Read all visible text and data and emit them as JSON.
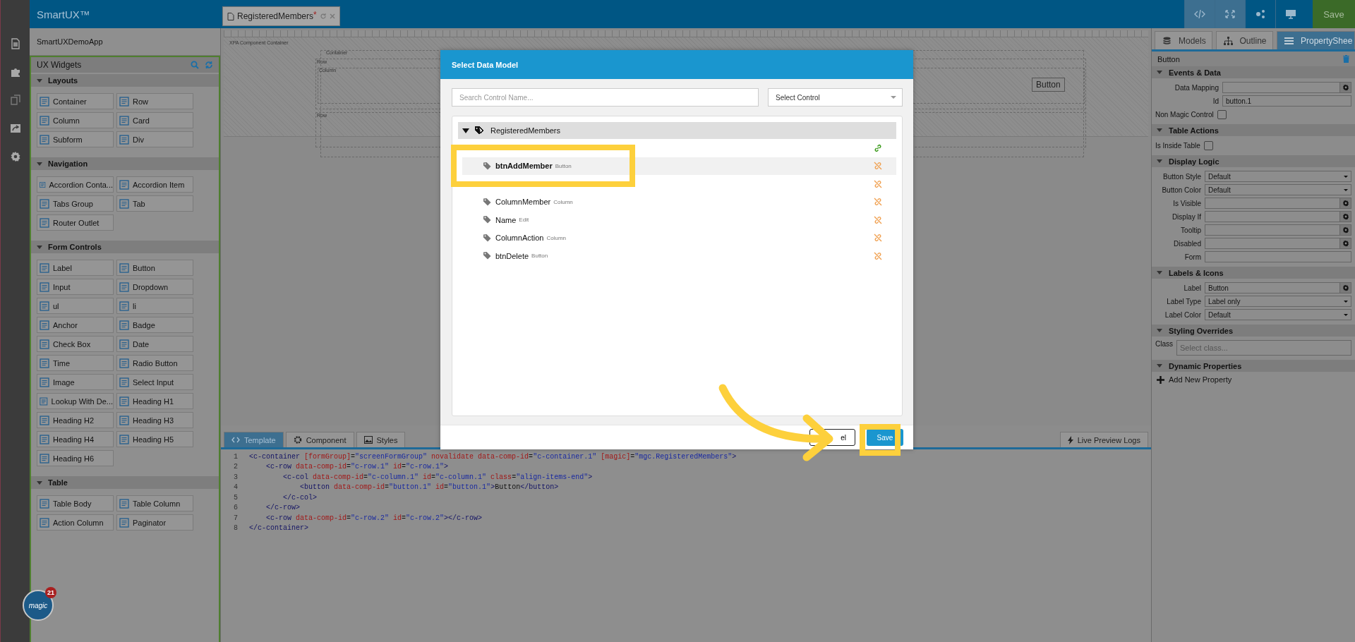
{
  "app": {
    "title": "SmartUX™",
    "project": "SmartUXDemoApp",
    "save": "Save"
  },
  "file_tab": {
    "label": "RegisteredMembers",
    "modified_mark": "*"
  },
  "toolbar": [
    {
      "kind": "code",
      "selected": true
    },
    {
      "kind": "expand",
      "selected": true
    },
    {
      "kind": "share",
      "selected": false
    },
    {
      "kind": "monitor",
      "selected": false
    }
  ],
  "widgets": {
    "title": "UX Widgets",
    "groups": [
      {
        "name": "Layouts",
        "expanded": true,
        "items": [
          "Container",
          "Row",
          "Column",
          "Card",
          "Subform",
          "Div"
        ]
      },
      {
        "name": "Navigation",
        "expanded": true,
        "items": [
          "Accordion Conta...",
          "Accordion Item",
          "Tabs Group",
          "Tab",
          "Router Outlet"
        ]
      },
      {
        "name": "Form Controls",
        "expanded": true,
        "items": [
          "Label",
          "Button",
          "Input",
          "Dropdown",
          "ul",
          "li",
          "Anchor",
          "Badge",
          "Check Box",
          "Date",
          "Time",
          "Radio Button",
          "Image",
          "Select Input",
          "Lookup With De...",
          "Heading H1",
          "Heading H2",
          "Heading H3",
          "Heading H4",
          "Heading H5",
          "Heading H6"
        ]
      },
      {
        "name": "Table",
        "expanded": true,
        "items": [
          "Table Body",
          "Table Column",
          "Action Column",
          "Paginator"
        ]
      }
    ]
  },
  "logo": {
    "text": "magic",
    "badge": "21"
  },
  "canvas": {
    "root_label": "XPA Component Container",
    "container_label": "Container",
    "row_labels": [
      "Row",
      "Row"
    ],
    "column_label": "Column",
    "button_label": "Button"
  },
  "bottom_tabs": [
    {
      "label": "Template",
      "selected": true
    },
    {
      "label": "Component",
      "selected": false
    },
    {
      "label": "Styles",
      "selected": false
    }
  ],
  "live_preview": "Live Preview Logs",
  "code": [
    {
      "number": "1",
      "tokens": [
        {
          "kind": "tag",
          "text": "<c-container "
        },
        {
          "kind": "attr",
          "text": "[formGroup]"
        },
        {
          "kind": "plain",
          "text": "="
        },
        {
          "kind": "value",
          "text": "\"screenFormGroup\""
        },
        {
          "kind": "attr",
          "text": " novalidate data-comp-id"
        },
        {
          "kind": "plain",
          "text": "="
        },
        {
          "kind": "value",
          "text": "\"c-container.1\""
        },
        {
          "kind": "attr",
          "text": " [magic]"
        },
        {
          "kind": "plain",
          "text": "="
        },
        {
          "kind": "value",
          "text": "\"mgc.RegisteredMembers\""
        },
        {
          "kind": "tag",
          "text": ">"
        }
      ]
    },
    {
      "number": "2",
      "tokens": [
        {
          "kind": "tag",
          "text": "    <c-row "
        },
        {
          "kind": "attr",
          "text": "data-comp-id"
        },
        {
          "kind": "plain",
          "text": "="
        },
        {
          "kind": "value",
          "text": "\"c-row.1\""
        },
        {
          "kind": "attr",
          "text": " id"
        },
        {
          "kind": "plain",
          "text": "="
        },
        {
          "kind": "value",
          "text": "\"c-row.1\""
        },
        {
          "kind": "tag",
          "text": ">"
        }
      ]
    },
    {
      "number": "3",
      "tokens": [
        {
          "kind": "tag",
          "text": "        <c-col "
        },
        {
          "kind": "attr",
          "text": "data-comp-id"
        },
        {
          "kind": "plain",
          "text": "="
        },
        {
          "kind": "value",
          "text": "\"c-column.1\""
        },
        {
          "kind": "attr",
          "text": " id"
        },
        {
          "kind": "plain",
          "text": "="
        },
        {
          "kind": "value",
          "text": "\"c-column.1\""
        },
        {
          "kind": "attr",
          "text": " class"
        },
        {
          "kind": "plain",
          "text": "="
        },
        {
          "kind": "value",
          "text": "\"align-items-end\""
        },
        {
          "kind": "tag",
          "text": ">"
        }
      ]
    },
    {
      "number": "4",
      "tokens": [
        {
          "kind": "tag",
          "text": "            <button "
        },
        {
          "kind": "attr",
          "text": "data-comp-id"
        },
        {
          "kind": "plain",
          "text": "="
        },
        {
          "kind": "value",
          "text": "\"button.1\""
        },
        {
          "kind": "attr",
          "text": " id"
        },
        {
          "kind": "plain",
          "text": "="
        },
        {
          "kind": "value",
          "text": "\"button.1\""
        },
        {
          "kind": "tag",
          "text": ">"
        },
        {
          "kind": "plain",
          "text": "Button"
        },
        {
          "kind": "tag",
          "text": "</button>"
        }
      ]
    },
    {
      "number": "5",
      "tokens": [
        {
          "kind": "tag",
          "text": "        </c-col>"
        }
      ]
    },
    {
      "number": "6",
      "tokens": [
        {
          "kind": "tag",
          "text": "    </c-row>"
        }
      ]
    },
    {
      "number": "7",
      "tokens": [
        {
          "kind": "tag",
          "text": "    <c-row "
        },
        {
          "kind": "attr",
          "text": "data-comp-id"
        },
        {
          "kind": "plain",
          "text": "="
        },
        {
          "kind": "value",
          "text": "\"c-row.2\""
        },
        {
          "kind": "attr",
          "text": " id"
        },
        {
          "kind": "plain",
          "text": "="
        },
        {
          "kind": "value",
          "text": "\"c-row.2\""
        },
        {
          "kind": "tag",
          "text": "></c-row>"
        }
      ]
    },
    {
      "number": "8",
      "tokens": [
        {
          "kind": "tag",
          "text": "</c-container>"
        }
      ]
    }
  ],
  "panel_tabs": [
    {
      "label": "Models",
      "selected": false
    },
    {
      "label": "Outline",
      "selected": false
    },
    {
      "label": "PropertyShee",
      "selected": true
    }
  ],
  "properties": {
    "title": "Button",
    "sections": [
      {
        "name": "Events & Data",
        "expanded": true,
        "fields": [
          {
            "label": "Data Mapping",
            "kind": "binding"
          },
          {
            "label": "Id",
            "kind": "text",
            "value": "button.1"
          },
          {
            "label": "Non Magic Control",
            "kind": "checkbox",
            "checked": false
          }
        ]
      },
      {
        "name": "Table Actions",
        "expanded": true,
        "fields": [
          {
            "label": "Is Inside Table",
            "kind": "checkbox",
            "checked": false
          }
        ]
      },
      {
        "name": "Display Logic",
        "expanded": true,
        "fields": [
          {
            "label": "Button Style",
            "kind": "select",
            "value": "Default"
          },
          {
            "label": "Button Color",
            "kind": "select",
            "value": "Default"
          },
          {
            "label": "Is Visible",
            "kind": "binding"
          },
          {
            "label": "Display If",
            "kind": "binding"
          },
          {
            "label": "Tooltip",
            "kind": "binding"
          },
          {
            "label": "Disabled",
            "kind": "binding"
          },
          {
            "label": "Form",
            "kind": "text"
          }
        ]
      },
      {
        "name": "Labels & Icons",
        "expanded": true,
        "fields": [
          {
            "label": "Label",
            "kind": "binding",
            "value": "Button"
          },
          {
            "label": "Label Type",
            "kind": "select",
            "value": "Label only"
          },
          {
            "label": "Label Color",
            "kind": "select",
            "value": "Default"
          }
        ]
      },
      {
        "name": "Styling Overrides",
        "expanded": true,
        "fields": [
          {
            "label": "Class",
            "kind": "class",
            "placeholder": "Select class..."
          }
        ]
      },
      {
        "name": "Dynamic Properties",
        "expanded": true,
        "fields": [
          {
            "label": "Add New Property",
            "kind": "add"
          }
        ]
      }
    ]
  },
  "modal": {
    "title": "Select Data Model",
    "search": {
      "placeholder": "Search Control Name..."
    },
    "select": {
      "value": "Select Control"
    },
    "tree": {
      "name": "RegisteredMembers",
      "expanded": true,
      "children": [
        {
          "linked": true,
          "selected": false
        },
        {
          "name": "btnAddMember",
          "type": "Button",
          "linked": false,
          "selected": true
        },
        {
          "linked": false,
          "selected": false
        },
        {
          "name": "ColumnMember",
          "type": "Column",
          "linked": false,
          "selected": false
        },
        {
          "name": "Name",
          "type": "Edit",
          "linked": false,
          "selected": false
        },
        {
          "name": "ColumnAction",
          "type": "Column",
          "linked": false,
          "selected": false
        },
        {
          "name": "btnDelete",
          "type": "Button",
          "linked": false,
          "selected": false
        }
      ]
    },
    "cancel": "el",
    "save": "Save"
  }
}
